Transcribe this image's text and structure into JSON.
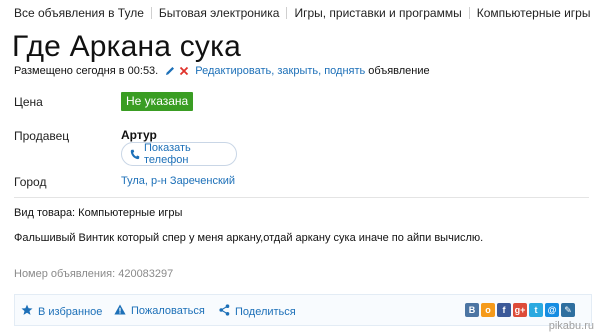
{
  "breadcrumbs": [
    "Все объявления в Туле",
    "Бытовая электроника",
    "Игры, приставки и программы",
    "Компьютерные игры"
  ],
  "title": "Где Аркана сука",
  "posted": {
    "text": "Размещено сегодня в 00:53.",
    "edit_link": "Редактировать, закрыть, поднять",
    "suffix": "объявление"
  },
  "price": {
    "label": "Цена",
    "value": "Не указана"
  },
  "seller": {
    "label": "Продавец",
    "name": "Артур",
    "phone_button": "Показать телефон"
  },
  "city": {
    "label": "Город",
    "value": "Тула, р-н Зареченский"
  },
  "category": "Вид товара: Компьютерные игры",
  "description": "Фальшивый Винтик который спер у меня аркану,отдай аркану сука иначе по айпи вычислю.",
  "ad_number": "Номер объявления: 420083297",
  "footer": {
    "favorite": "В избранное",
    "report": "Пожаловаться",
    "share": "Поделиться"
  },
  "socials": [
    {
      "name": "vk",
      "glyph": "В",
      "color": "#4c75a3"
    },
    {
      "name": "odnoklassniki",
      "glyph": "о",
      "color": "#f59a1a"
    },
    {
      "name": "facebook",
      "glyph": "f",
      "color": "#3b5998"
    },
    {
      "name": "google-plus",
      "glyph": "g+",
      "color": "#dd4b39"
    },
    {
      "name": "twitter",
      "glyph": "t",
      "color": "#2aa9e0"
    },
    {
      "name": "mail-ru",
      "glyph": "@",
      "color": "#168de2"
    },
    {
      "name": "livejournal",
      "glyph": "✎",
      "color": "#2f6f9f"
    }
  ],
  "watermark": "pikabu.ru",
  "colors": {
    "accent": "#1d70b8",
    "badge": "#3a9d23"
  }
}
